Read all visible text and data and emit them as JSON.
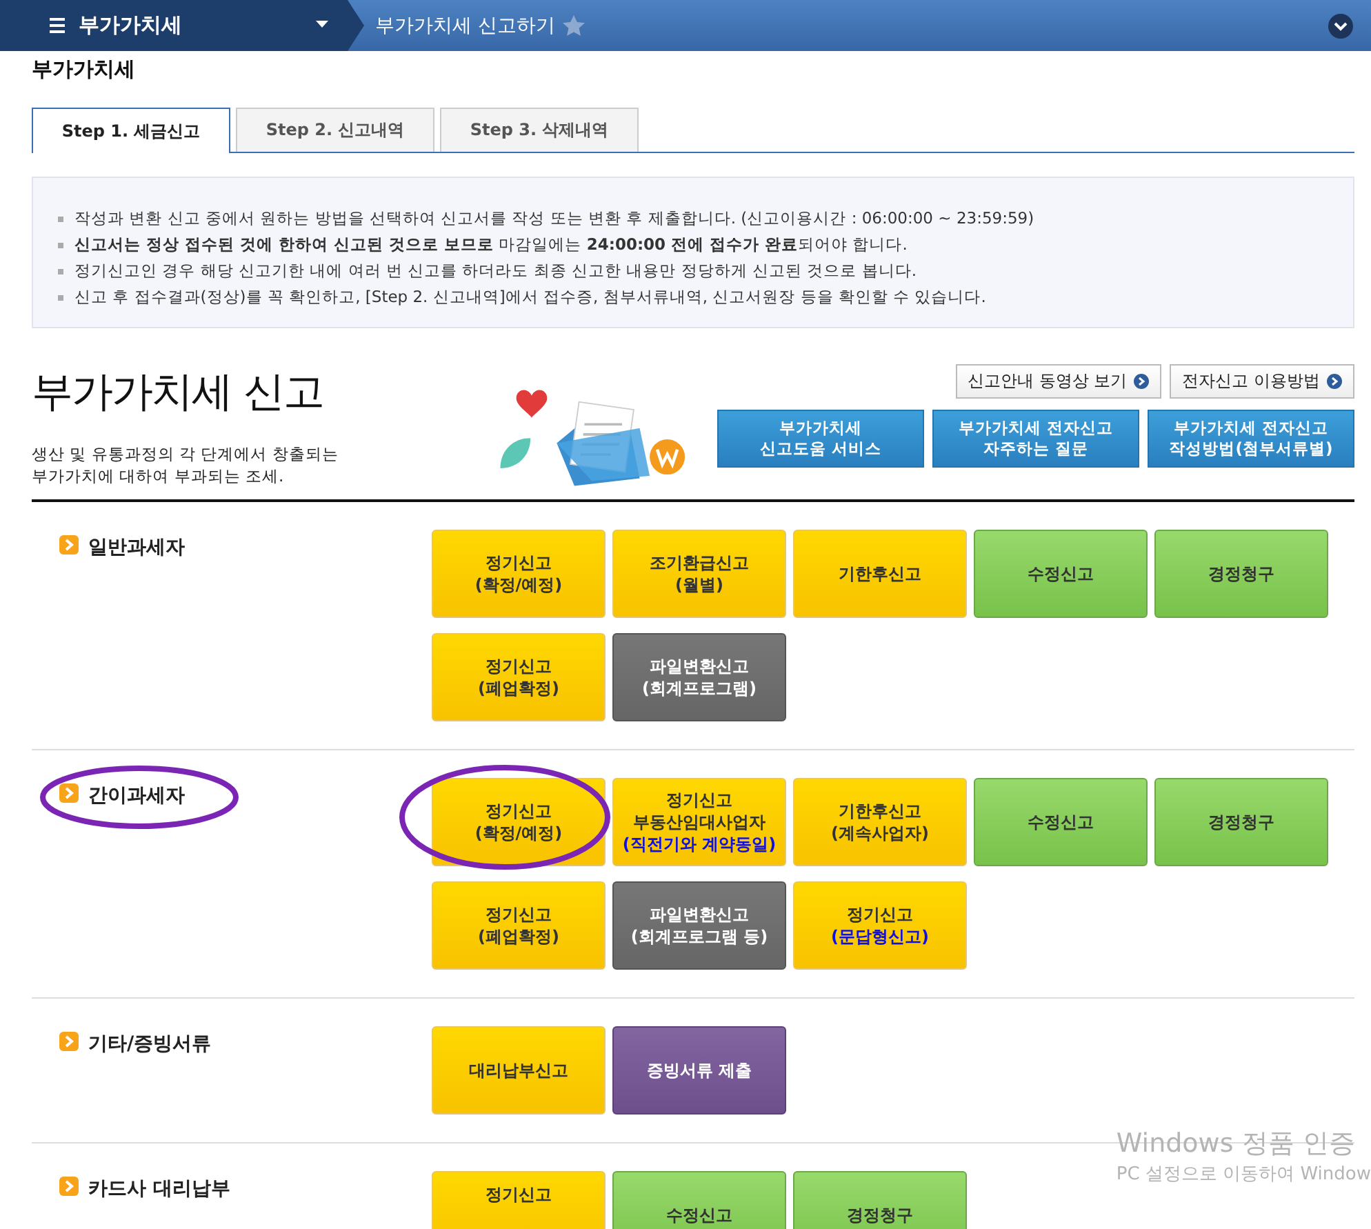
{
  "topbar": {
    "menu_title": "부가가치세",
    "breadcrumb": "부가가치세 신고하기",
    "favorite": false
  },
  "page_title": "부가가치세",
  "tabs": [
    {
      "label": "Step 1. 세금신고",
      "selected": true
    },
    {
      "label": "Step 2. 신고내역",
      "selected": false
    },
    {
      "label": "Step 3. 삭제내역",
      "selected": false
    }
  ],
  "notices": [
    "작성과 변환 신고 중에서 원하는 방법을 선택하여 신고서를 작성 또는 변환 후 제출합니다. (신고이용시간 : 06:00:00 ~ 23:59:59)",
    "**신고서는 정상 접수된 것에 한하여 신고된 것으로 보므로** 마감일에는 **24:00:00 전에 접수가 완료**되어야 합니다.",
    "정기신고인 경우 해당 신고기한 내에 여러 번 신고를 하더라도 최종 신고한 내용만 정당하게 신고된 것으로 봅니다.",
    "신고 후 접수결과(정상)를 꼭 확인하고, [Step 2. 신고내역]에서 접수증, 첨부서류내역, 신고서원장 등을 확인할 수 있습니다."
  ],
  "hero": {
    "title": "부가가치세 신고",
    "description": [
      "생산 및 유통과정의 각 단계에서 창출되는",
      "부가가치에 대하여 부과되는 조세."
    ],
    "links": [
      "신고안내 동영상 보기",
      "전자신고 이용방법"
    ],
    "services": [
      {
        "lines": [
          "부가가치세",
          "신고도움 서비스"
        ]
      },
      {
        "lines": [
          "부가가치세 전자신고",
          "자주하는 질문"
        ]
      },
      {
        "lines": [
          "부가가치세 전자신고",
          "작성방법(첨부서류별)"
        ]
      }
    ]
  },
  "sections": [
    {
      "label": "일반과세자",
      "circled": false,
      "buttons": [
        {
          "kind": "filing",
          "circled": false,
          "lines": [
            "정기신고",
            "(확정/예정)"
          ]
        },
        {
          "kind": "filing",
          "circled": false,
          "lines": [
            "조기환급신고",
            "(월별)"
          ]
        },
        {
          "kind": "filing",
          "circled": false,
          "lines": [
            "기한후신고"
          ]
        },
        {
          "kind": "correction",
          "circled": false,
          "lines": [
            "수정신고"
          ]
        },
        {
          "kind": "correction",
          "circled": false,
          "lines": [
            "경정청구"
          ]
        },
        {
          "kind": "filing",
          "circled": false,
          "lines": [
            "정기신고",
            "(폐업확정)"
          ]
        },
        {
          "kind": "conversion",
          "circled": false,
          "lines": [
            "파일변환신고",
            "(회계프로그램)"
          ]
        }
      ]
    },
    {
      "label": "간이과세자",
      "circled": true,
      "buttons": [
        {
          "kind": "filing",
          "circled": true,
          "lines": [
            "정기신고",
            "(확정/예정)"
          ]
        },
        {
          "kind": "filing",
          "circled": false,
          "lines": [
            "정기신고",
            "부동산임대사업자"
          ],
          "note": "(직전기와 계약동일)"
        },
        {
          "kind": "filing",
          "circled": false,
          "lines": [
            "기한후신고",
            "(계속사업자)"
          ]
        },
        {
          "kind": "correction",
          "circled": false,
          "lines": [
            "수정신고"
          ]
        },
        {
          "kind": "correction",
          "circled": false,
          "lines": [
            "경정청구"
          ]
        },
        {
          "kind": "filing",
          "circled": false,
          "lines": [
            "정기신고",
            "(폐업확정)"
          ]
        },
        {
          "kind": "conversion",
          "circled": false,
          "lines": [
            "파일변환신고",
            "(회계프로그램 등)"
          ]
        },
        {
          "kind": "filing",
          "circled": false,
          "lines": [
            "정기신고"
          ],
          "note": "(문답형신고)"
        }
      ]
    },
    {
      "label": "기타/증빙서류",
      "circled": false,
      "buttons": [
        {
          "kind": "filing",
          "circled": false,
          "lines": [
            "대리납부신고"
          ]
        },
        {
          "kind": "evidence",
          "circled": false,
          "lines": [
            "증빙서류 제출"
          ]
        }
      ]
    },
    {
      "label": "카드사 대리납부",
      "circled": false,
      "buttons": [
        {
          "kind": "filing",
          "circled": false,
          "lines": [
            "정기신고"
          ],
          "top": true
        },
        {
          "kind": "correction",
          "circled": false,
          "lines": [
            "수정신고"
          ]
        },
        {
          "kind": "correction",
          "circled": false,
          "lines": [
            "경정청구"
          ]
        }
      ]
    }
  ],
  "os_notice": [
    "Windows 정품 인증",
    "PC 설정으로 이동하여 Window"
  ]
}
